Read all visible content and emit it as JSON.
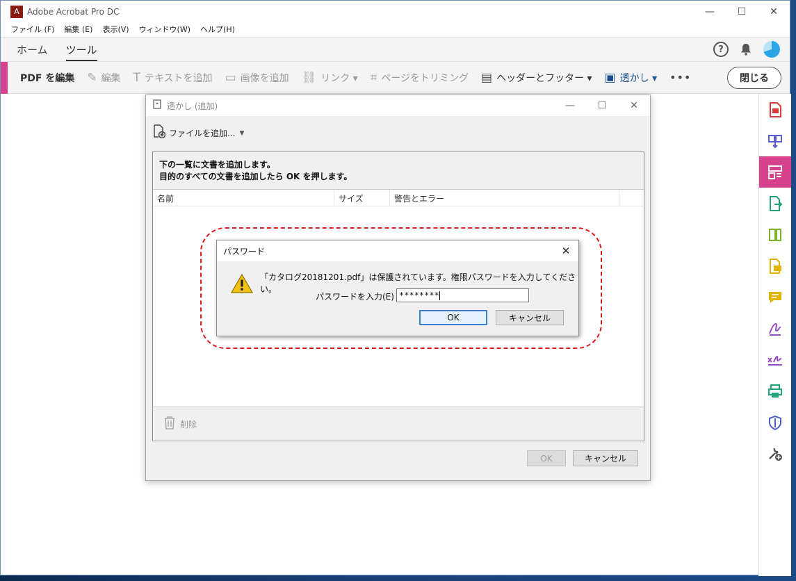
{
  "app": {
    "title": "Adobe Acrobat Pro DC",
    "logo_glyph": "A"
  },
  "window_controls": {
    "minimize": "—",
    "maximize": "☐",
    "close": "✕"
  },
  "menu": [
    "ファイル (F)",
    "編集 (E)",
    "表示(V)",
    "ウィンドウ(W)",
    "ヘルプ(H)"
  ],
  "nav": {
    "tabs": [
      "ホーム",
      "ツール"
    ],
    "active": "ツール",
    "help_glyph": "?"
  },
  "toolbar": {
    "label": "PDF を編集",
    "items": [
      {
        "label": "編集",
        "icon": "edit-icon",
        "glyph": "✎"
      },
      {
        "label": "テキストを追加",
        "icon": "text-icon",
        "glyph": "T"
      },
      {
        "label": "画像を追加",
        "icon": "image-icon",
        "glyph": "▭"
      },
      {
        "label": "リンク ▾",
        "icon": "link-icon",
        "glyph": "⛓"
      },
      {
        "label": "ページをトリミング",
        "icon": "crop-icon",
        "glyph": "⌗"
      },
      {
        "label": "ヘッダーとフッター ▾",
        "icon": "header-footer-icon",
        "glyph": "▤"
      },
      {
        "label": "透かし ▾",
        "icon": "watermark-icon",
        "glyph": "▣"
      }
    ],
    "more": "•••",
    "close": "閉じる"
  },
  "watermark_dialog": {
    "title": "透かし (追加)",
    "add_files": "ファイルを追加...",
    "instructions_line1": "下の一覧に文書を追加します。",
    "instructions_line2": "目的のすべての文書を追加したら OK を押します。",
    "columns": [
      "名前",
      "サイズ",
      "警告とエラー"
    ],
    "delete": "削除",
    "ok": "OK",
    "cancel": "キャンセル"
  },
  "password_dialog": {
    "title": "パスワード",
    "message": "「カタログ20181201.pdf」は保護されています。権限パスワードを入力してください。",
    "label": "パスワードを入力(E) :",
    "value": "********",
    "ok": "OK",
    "cancel": "キャンセル"
  },
  "colors": {
    "accent": "#d6428e",
    "highlight_dash": "#dd1c1c",
    "link_blue": "#1a4f8f"
  }
}
